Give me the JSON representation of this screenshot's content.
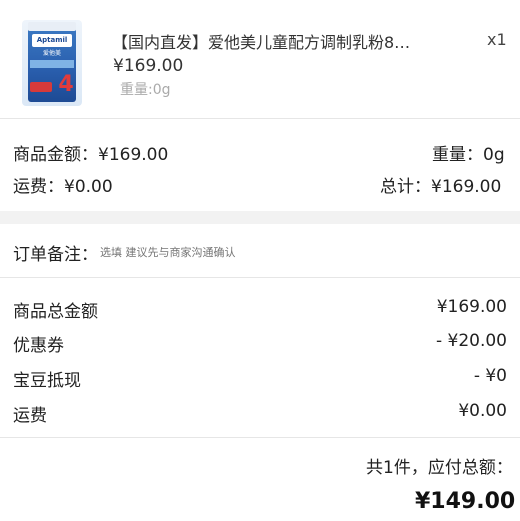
{
  "product": {
    "title": "【国内直发】爱他美儿童配方调制乳粉8…",
    "quantity": "x1",
    "price": "¥169.00",
    "weight": "重量:0g",
    "image": {
      "brand": "Aptamil",
      "brand_cn": "爱他美",
      "stage": "4"
    }
  },
  "summary": {
    "goods_amount_label": "商品金额：",
    "goods_amount_value": "¥169.00",
    "weight_label": "重量：",
    "weight_value": "0g",
    "shipping_label": "运费：",
    "shipping_value": "¥0.00",
    "total_label": "总计：",
    "total_value": "¥169.00"
  },
  "remark": {
    "label": "订单备注：",
    "placeholder": "选填 建议先与商家沟通确认"
  },
  "breakdown": [
    {
      "label": "商品总金额",
      "value": "¥169.00"
    },
    {
      "label": "优惠券",
      "value": "- ¥20.00"
    },
    {
      "label": "宝豆抵现",
      "value": "- ¥0"
    },
    {
      "label": "运费",
      "value": "¥0.00"
    }
  ],
  "footer": {
    "count_label": "共1件，应付总额：",
    "amount": "¥149.00"
  },
  "colors": {
    "page_bg": "#ffffff",
    "gap_bg": "#f2f2f2",
    "divider": "#e6e6e6",
    "muted_text": "#aaaaaa"
  }
}
